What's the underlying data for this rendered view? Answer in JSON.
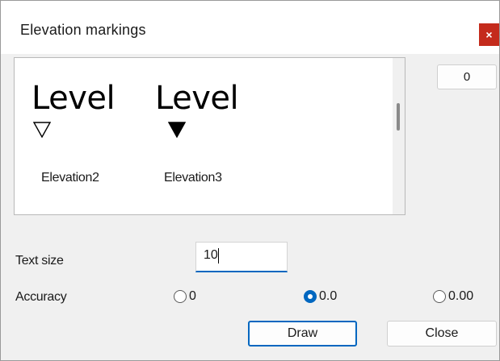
{
  "dialog": {
    "title": "Elevation markings",
    "close_glyph": "×"
  },
  "preview": {
    "marks": [
      {
        "level_text": "Level",
        "name": "Elevation2",
        "triangle": "outline"
      },
      {
        "level_text": "Level",
        "name": "Elevation3",
        "triangle": "filled"
      }
    ]
  },
  "counter": {
    "value": "0"
  },
  "text_size": {
    "label": "Text size",
    "value": "10"
  },
  "accuracy": {
    "label": "Accuracy",
    "options": [
      "0",
      "0.0",
      "0.00"
    ],
    "selected": "0.0"
  },
  "buttons": {
    "draw": "Draw",
    "close": "Close"
  },
  "colors": {
    "accent": "#0067c0",
    "close_red": "#c42b1c",
    "dialog_bg": "#f0f0f0"
  }
}
